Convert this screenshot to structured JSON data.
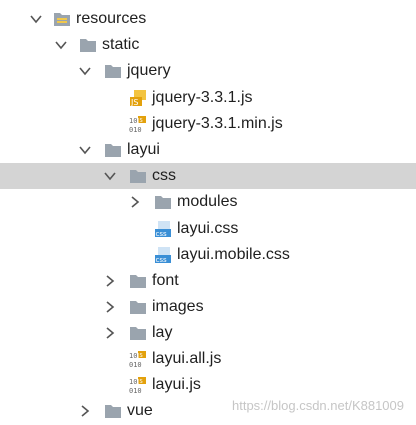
{
  "tree": {
    "resources": {
      "label": "resources"
    },
    "static": {
      "label": "static"
    },
    "jquery": {
      "label": "jquery"
    },
    "jquery_js": {
      "label": "jquery-3.3.1.js"
    },
    "jquery_min_js": {
      "label": "jquery-3.3.1.min.js"
    },
    "layui": {
      "label": "layui"
    },
    "css": {
      "label": "css"
    },
    "modules": {
      "label": "modules"
    },
    "layui_css": {
      "label": "layui.css"
    },
    "layui_mobile_css": {
      "label": "layui.mobile.css"
    },
    "font": {
      "label": "font"
    },
    "images": {
      "label": "images"
    },
    "lay": {
      "label": "lay"
    },
    "layui_all_js": {
      "label": "layui.all.js"
    },
    "layui_js": {
      "label": "layui.js"
    },
    "vue": {
      "label": "vue"
    }
  },
  "watermark": "https://blog.csdn.net/K881009",
  "colors": {
    "folder": "#9aa4ae",
    "selected_row": "#d4d4d4",
    "js_badge": "#e3a10c",
    "css_badge": "#3a8fd6"
  }
}
